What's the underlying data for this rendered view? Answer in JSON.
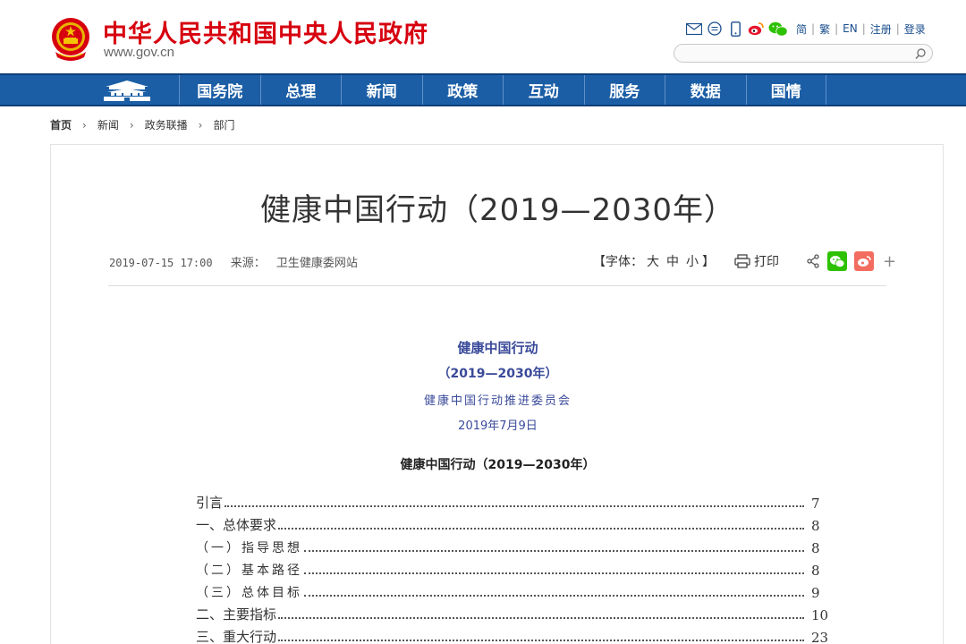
{
  "header": {
    "site_title": "中华人民共和国中央人民政府",
    "site_url": "www.gov.cn",
    "top_links": [
      "简",
      "繁",
      "EN",
      "注册",
      "登录"
    ],
    "search_placeholder": ""
  },
  "nav": {
    "items": [
      "国务院",
      "总理",
      "新闻",
      "政策",
      "互动",
      "服务",
      "数据",
      "国情"
    ]
  },
  "breadcrumb": [
    "首页",
    "新闻",
    "政务联播",
    "部门"
  ],
  "article": {
    "title": "健康中国行动（2019—2030年）",
    "date": "2019-07-15 17:00",
    "source_label": "来源：",
    "source": "卫生健康委网站",
    "font_size_open": "【字体：",
    "font_sizes": [
      "大",
      "中",
      "小"
    ],
    "font_size_close": "】",
    "print_label": "打印",
    "plus": "+"
  },
  "document": {
    "heading": "健康中国行动",
    "years": "（2019—2030年）",
    "committee": "健康中国行动推进委员会",
    "date": "2019年7月9日",
    "toc_title": "健康中国行动（2019—2030年）",
    "toc": [
      {
        "label": "引言",
        "page": "7"
      },
      {
        "label": "一、总体要求",
        "page": "8"
      },
      {
        "label": "（一）指导思想",
        "page": "8"
      },
      {
        "label": "（二）基本路径",
        "page": "8"
      },
      {
        "label": "（三）总体目标",
        "page": "9"
      },
      {
        "label": "二、主要指标",
        "page": "10"
      },
      {
        "label": "三、重大行动",
        "page": "23"
      }
    ]
  },
  "colors": {
    "brand_red": "#d7000f",
    "nav_blue": "#1b5ea6",
    "doc_blue": "#3a4a9a",
    "wechat_green": "#2dc100",
    "weibo_orange": "#f26d5f"
  }
}
